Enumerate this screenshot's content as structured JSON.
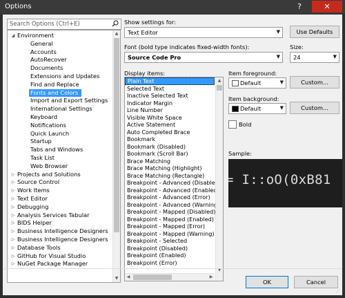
{
  "window": {
    "title": "Options",
    "help_label": "?",
    "close_label": "✕"
  },
  "search": {
    "placeholder": "Search Options (Ctrl+E)",
    "icon": "search-icon"
  },
  "tree": {
    "items": [
      {
        "label": "Environment",
        "expanded": true
      },
      {
        "label": "General"
      },
      {
        "label": "Accounts"
      },
      {
        "label": "AutoRecover"
      },
      {
        "label": "Documents"
      },
      {
        "label": "Extensions and Updates"
      },
      {
        "label": "Find and Replace"
      },
      {
        "label": "Fonts and Colors",
        "selected": true
      },
      {
        "label": "Import and Export Settings"
      },
      {
        "label": "International Settings"
      },
      {
        "label": "Keyboard"
      },
      {
        "label": "Notifications"
      },
      {
        "label": "Quick Launch"
      },
      {
        "label": "Startup"
      },
      {
        "label": "Tabs and Windows"
      },
      {
        "label": "Task List"
      },
      {
        "label": "Web Browser"
      },
      {
        "label": "Projects and Solutions"
      },
      {
        "label": "Source Control"
      },
      {
        "label": "Work Items"
      },
      {
        "label": "Text Editor"
      },
      {
        "label": "Debugging"
      },
      {
        "label": "Analysis Services Tabular"
      },
      {
        "label": "BIDS Helper"
      },
      {
        "label": "Business Intelligence Designers"
      },
      {
        "label": "Business Intelligence Designers"
      },
      {
        "label": "Database Tools"
      },
      {
        "label": "GitHub for Visual Studio"
      },
      {
        "label": "NuGet Package Manager"
      }
    ]
  },
  "show_settings": {
    "label": "Show settings for:",
    "value": "Text Editor",
    "use_defaults": "Use Defaults"
  },
  "font": {
    "label": "Font (bold type indicates fixed-width fonts):",
    "value": "Source Code Pro"
  },
  "size": {
    "label": "Size:",
    "value": "24"
  },
  "display_items": {
    "label": "Display items:",
    "items": [
      "Plain Text",
      "Selected Text",
      "Inactive Selected Text",
      "Indicator Margin",
      "Line Number",
      "Visible White Space",
      "Active Statement",
      "Auto Completed Brace",
      "Bookmark",
      "Bookmark (Disabled)",
      "Bookmark (Scroll Bar)",
      "Brace Matching",
      "Brace Matching (Highlight)",
      "Brace Matching (Rectangle)",
      "Breakpoint - Advanced (Disabled)",
      "Breakpoint - Advanced (Enabled)",
      "Breakpoint - Advanced (Error)",
      "Breakpoint - Advanced (Warning)",
      "Breakpoint - Mapped (Disabled)",
      "Breakpoint - Mapped (Enabled)",
      "Breakpoint - Mapped (Error)",
      "Breakpoint - Mapped (Warning)",
      "Breakpoint - Selected",
      "Breakpoint (Disabled)",
      "Breakpoint (Enabled)",
      "Breakpoint (Error)"
    ]
  },
  "item_foreground": {
    "label": "Item foreground:",
    "value": "Default",
    "swatch_color": "#ffffff",
    "custom": "Custom..."
  },
  "item_background": {
    "label": "Item background:",
    "value": "Default",
    "swatch_color": "#000000",
    "custom": "Custom..."
  },
  "bold": {
    "label": "Bold",
    "checked": false
  },
  "sample": {
    "label": "Sample:",
    "text": "= I::oO(0xB81"
  },
  "footer": {
    "ok": "OK",
    "cancel": "Cancel"
  },
  "colors": {
    "selection": "#3399ff",
    "close_red": "#c42b1c",
    "titlebar": "#3a3a3a"
  }
}
